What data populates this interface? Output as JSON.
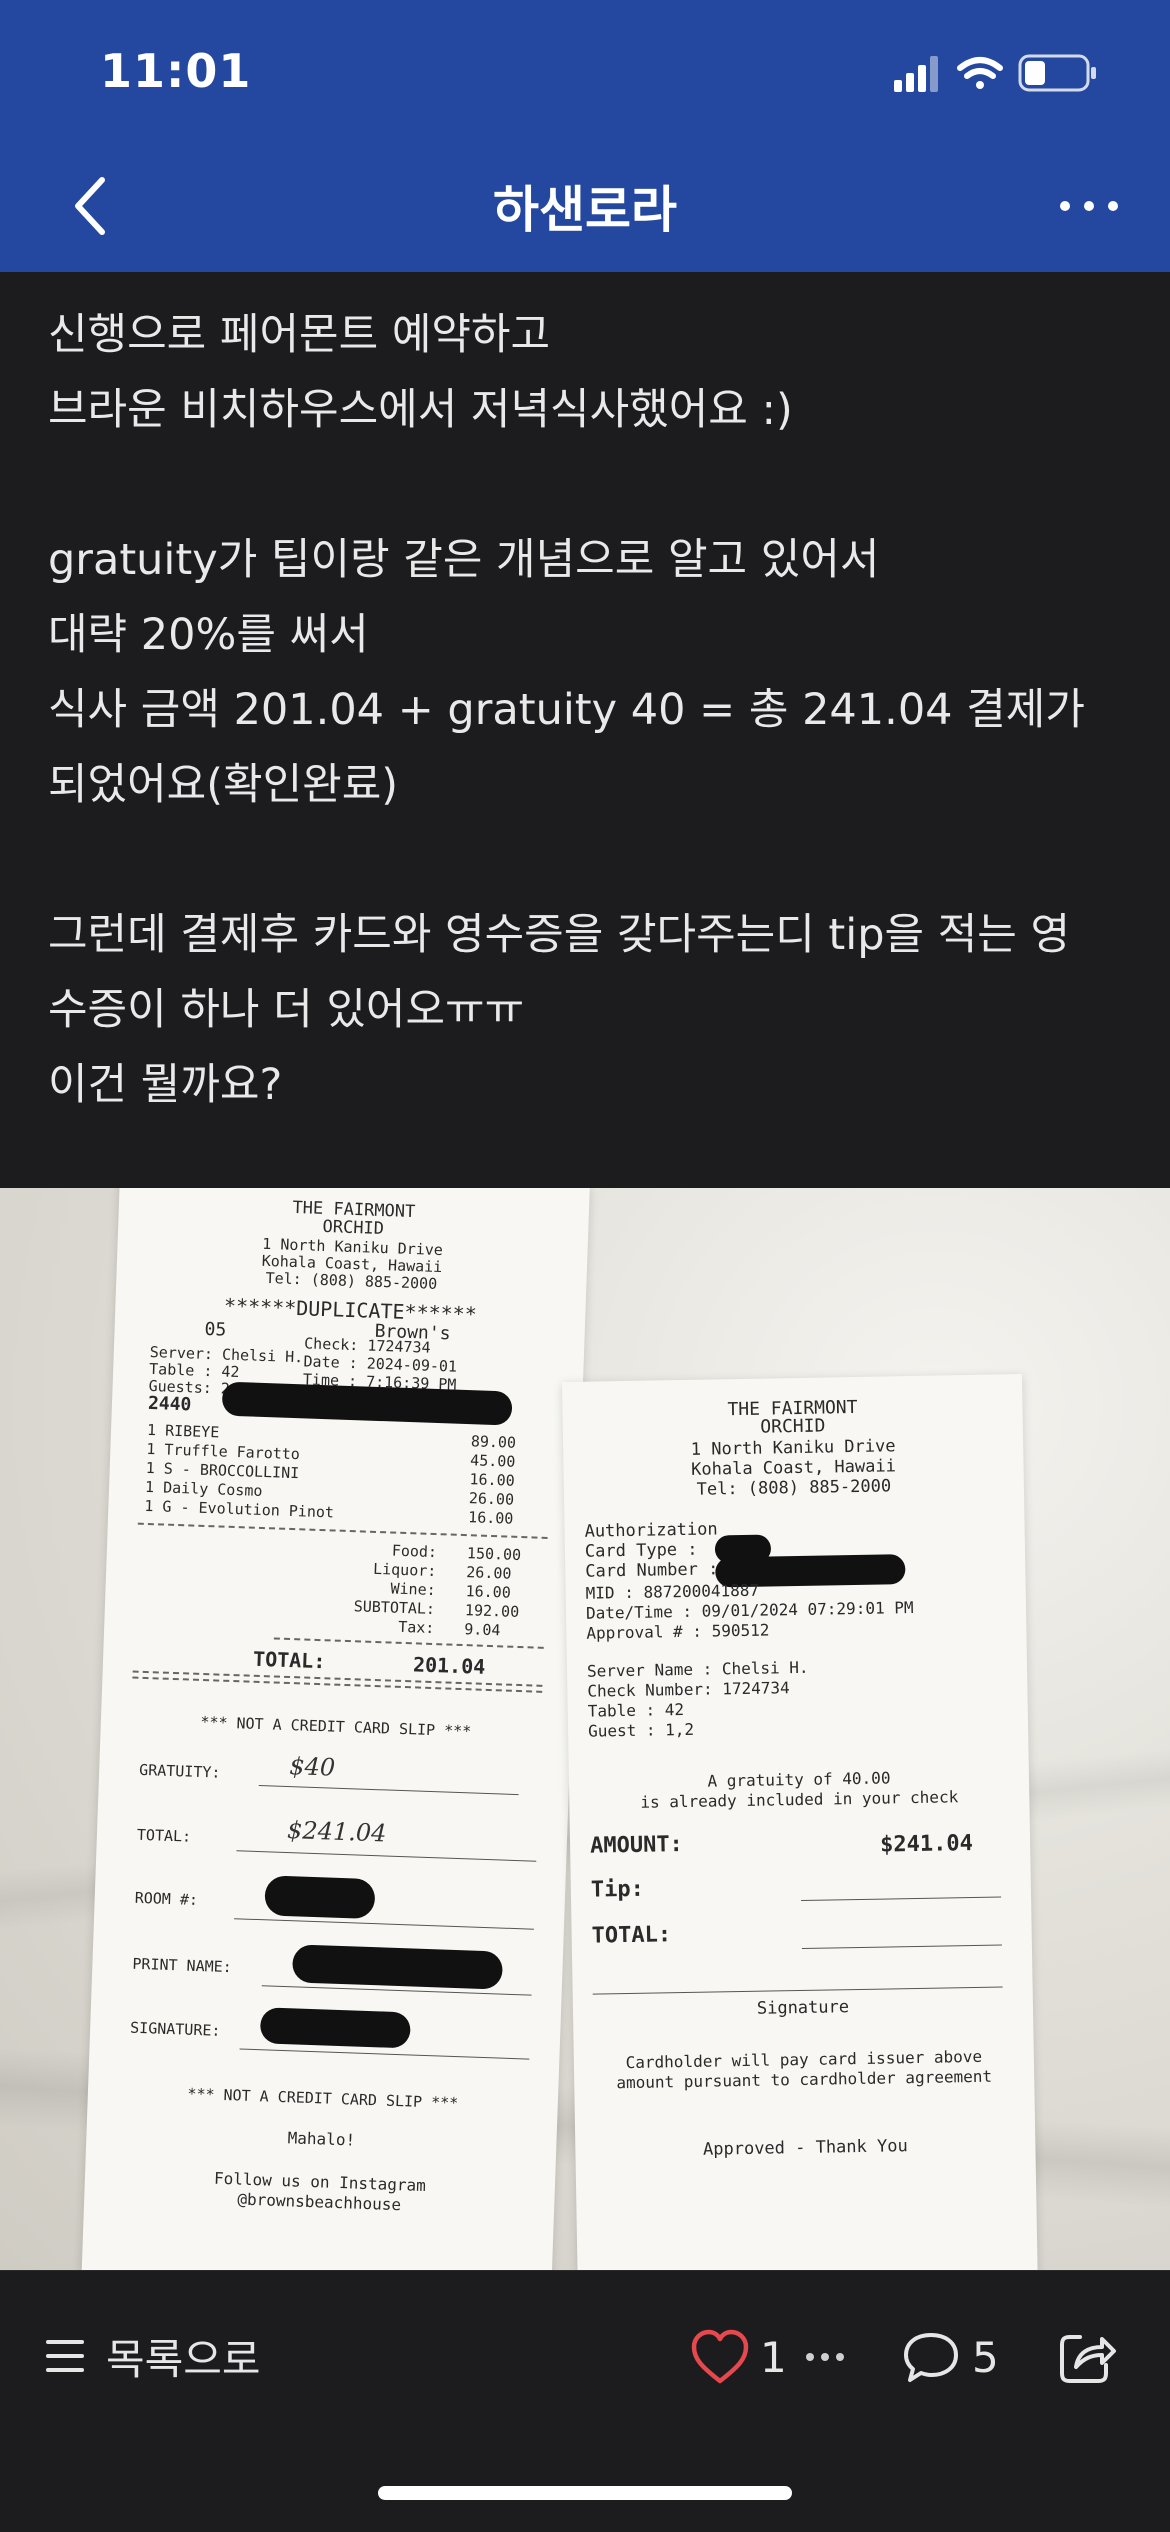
{
  "status_bar": {
    "time": "11:01"
  },
  "header": {
    "title": "하샌로라"
  },
  "post": {
    "lines": [
      "신행으로 페어몬트 예약하고",
      "브라운 비치하우스에서 저녁식사했어요 :)",
      "",
      "gratuity가 팁이랑 같은 개념으로 알고 있어서",
      "대략 20%를 써서",
      "식사 금액 201.04 + gratuity 40 = 총 241.04 결제가",
      "되었어요(확인완료)",
      "",
      "그런데 결제후 카드와 영수증을 갖다주는디 tip을 적는 영",
      "수증이 하나 더 있어오ㅠㅠ",
      "이건 뭘까요?"
    ]
  },
  "receipt_left": {
    "hotel_line1": "THE FAIRMONT",
    "hotel_line2": "ORCHID",
    "address1": "1 North Kaniku Drive",
    "address2": "Kohala Coast, Hawaii",
    "phone": "Tel: (808) 885-2000",
    "duplicate": "******DUPLICATE******",
    "restaurant": "Brown's",
    "code": "05",
    "server": "Server: Chelsi H.",
    "table": "Table : 42",
    "guests": "Guests: 2",
    "number": "2440",
    "check": "Check: 1724734",
    "date": "Date : 2024-09-01",
    "time": "Time : 7:16:39 PM",
    "items": [
      {
        "name": "1 RIBEYE",
        "price": "89.00"
      },
      {
        "name": "1 Truffle Farotto",
        "price": "45.00"
      },
      {
        "name": "1 S - BROCCOLLINI",
        "price": "16.00"
      },
      {
        "name": "1 Daily Cosmo",
        "price": "26.00"
      },
      {
        "name": "1 G - Evolution Pinot",
        "price": "16.00"
      }
    ],
    "totals": [
      {
        "label": "Food:",
        "value": "150.00"
      },
      {
        "label": "Liquor:",
        "value": "26.00"
      },
      {
        "label": "Wine:",
        "value": "16.00"
      },
      {
        "label": "SUBTOTAL:",
        "value": "192.00"
      },
      {
        "label": "Tax:",
        "value": "9.04"
      }
    ],
    "total_label": "TOTAL:",
    "total_value": "201.04",
    "not_credit_1": "*** NOT A CREDIT CARD SLIP ***",
    "gratuity_label": "GRATUITY:",
    "gratuity_value": "$40",
    "total2_label": "TOTAL:",
    "total2_value": "$241.04",
    "room_label": "ROOM #:",
    "print_name_label": "PRINT NAME:",
    "signature_label": "SIGNATURE:",
    "not_credit_2": "*** NOT A CREDIT CARD SLIP ***",
    "mahalo": "Mahalo!",
    "follow": "Follow us on Instagram",
    "instagram": "@brownsbeachhouse"
  },
  "receipt_right": {
    "hotel_line1": "THE FAIRMONT",
    "hotel_line2": "ORCHID",
    "address1": "1 North Kaniku Drive",
    "address2": "Kohala Coast, Hawaii",
    "phone": "Tel: (808) 885-2000",
    "authorization": "Authorization",
    "card_type": "Card Type   :",
    "card_number": "Card Number :",
    "mid": "MID         : 887200041887",
    "datetime": "Date/Time   : 09/01/2024 07:29:01 PM",
    "approval": "Approval #  : 590512",
    "server_name": "Server Name : Chelsi H.",
    "check_number": "Check Number: 1724734",
    "table": "Table       : 42",
    "guest": "Guest       : 1,2",
    "gratuity_note1": "A gratuity of 40.00",
    "gratuity_note2": "is already included in your check",
    "amount_label": "AMOUNT:",
    "amount_value": "$241.04",
    "tip_label": "Tip:",
    "total_label": "TOTAL:",
    "signature": "Signature",
    "cardholder1": "Cardholder will pay card issuer above",
    "cardholder2": "amount pursuant to cardholder agreement",
    "approved": "Approved - Thank You"
  },
  "bottom_bar": {
    "list_label": "목록으로",
    "like_count": "1",
    "comment_count": "5"
  },
  "colors": {
    "header_bg": "#2448a0",
    "page_bg": "#1c1c1e",
    "like_red": "#e5484d"
  }
}
